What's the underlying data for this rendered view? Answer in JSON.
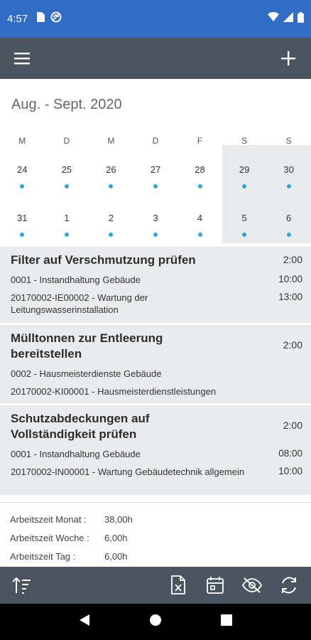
{
  "status": {
    "time": "4:57"
  },
  "calendar": {
    "month_title": "Aug. - Sept. 2020",
    "day_headers": [
      "M",
      "D",
      "M",
      "D",
      "F",
      "S",
      "S"
    ],
    "week1": [
      "24",
      "25",
      "26",
      "27",
      "28",
      "29",
      "30"
    ],
    "week2": [
      "31",
      "1",
      "2",
      "3",
      "4",
      "5",
      "6"
    ]
  },
  "tasks": [
    {
      "title": "Filter auf Verschmutzung prüfen",
      "duration": "2:00",
      "lines": [
        {
          "text": "0001 - Instandhaltung Gebäude",
          "time": "10:00"
        },
        {
          "text": "20170002-IE00002 - Wartung der Leitungswasserinstallation",
          "time": "13:00"
        }
      ]
    },
    {
      "title": "Mülltonnen zur Entleerung bereitstellen",
      "duration": "2:00",
      "lines": [
        {
          "text": "0002 - Hausmeisterdienste Gebäude",
          "time": ""
        },
        {
          "text": "20170002-KI00001 - Hausmeisterdienstleistungen",
          "time": ""
        }
      ]
    },
    {
      "title": "Schutzabdeckungen auf Vollständigkeit prüfen",
      "duration": "2:00",
      "lines": [
        {
          "text": "0001 - Instandhaltung Gebäude",
          "time": "08:00"
        },
        {
          "text": "20170002-IN00001 - Wartung Gebäudetechnik allgemein",
          "time": "10:00"
        }
      ]
    }
  ],
  "summary": {
    "month_label": "Arbeitszeit Monat :",
    "month_value": "38,00h",
    "week_label": "Arbeitszeit Woche :",
    "week_value": "6,00h",
    "day_label": "Arbeitszeit Tag :",
    "day_value": "6,00h"
  },
  "colors": {
    "statusbar": "#2f6dc6",
    "appbar": "#4a5560",
    "dot": "#2aa8e0",
    "card": "#e9ebed"
  },
  "icons": [
    "menu-icon",
    "plus-icon",
    "sort-icon",
    "excel-export-icon",
    "calendar-icon",
    "visibility-off-icon",
    "refresh-icon"
  ]
}
